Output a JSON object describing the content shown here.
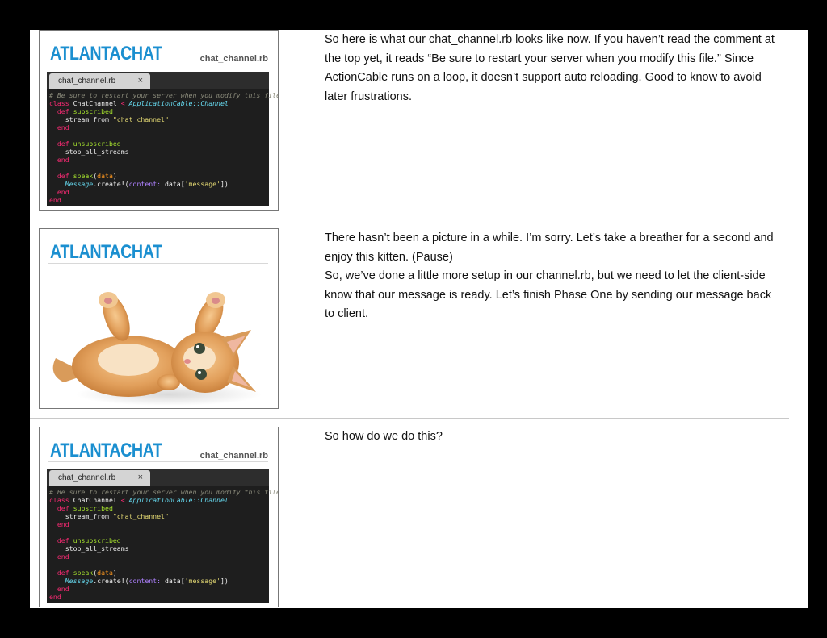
{
  "slides": [
    {
      "brand": "ATLANTACHAT",
      "file_label": "chat_channel.rb",
      "tab_label": "chat_channel.rb",
      "tab_close": "×",
      "code": {
        "l1": "# Be sure to restart your server when you modify this file.",
        "l2_kw": "class",
        "l2_name": " ChatChannel",
        "l2_op": " < ",
        "l2_parent": "ApplicationCable::Channel",
        "l3_kw": "  def",
        "l3_fn": " subscribed",
        "l4_call": "    stream_from ",
        "l4_str": "\"chat_channel\"",
        "l5": "  end",
        "l7_kw": "  def",
        "l7_fn": " unsubscribed",
        "l8": "    stop_all_streams",
        "l9": "  end",
        "l11_kw": "  def",
        "l11_fn": " speak",
        "l11_open": "(",
        "l11_arg": "data",
        "l11_close": ")",
        "l12_cls": "    Message",
        "l12_call": ".create!(",
        "l12_sym": "content:",
        "l12_rest": " data[",
        "l12_str": "'message'",
        "l12_end": "])",
        "l13": "  end",
        "l14": "end"
      },
      "note": [
        "So here is what our chat_channel.rb looks like now. If you haven’t read the comment at the top yet, it reads “Be sure to restart your server when you modify this file.” Since ActionCable runs on a loop, it doesn’t support auto reloading. Good to know to avoid later frustrations."
      ]
    },
    {
      "brand": "ATLANTACHAT",
      "image": "kitten-photo",
      "note": [
        "There hasn’t been a picture in a while. I’m sorry. Let’s take a breather for a second and enjoy this kitten. (Pause)",
        "So, we’ve done a little more setup in our channel.rb, but we need to let the client-side know that our message is ready. Let’s finish Phase One by sending our message back to client."
      ]
    },
    {
      "brand": "ATLANTACHAT",
      "file_label": "chat_channel.rb",
      "tab_label": "chat_channel.rb",
      "tab_close": "×",
      "code": {
        "l1": "# Be sure to restart your server when you modify this file.",
        "l2_kw": "class",
        "l2_name": " ChatChannel",
        "l2_op": " < ",
        "l2_parent": "ApplicationCable::Channel",
        "l3_kw": "  def",
        "l3_fn": " subscribed",
        "l4_call": "    stream_from ",
        "l4_str": "\"chat_channel\"",
        "l5": "  end",
        "l7_kw": "  def",
        "l7_fn": " unsubscribed",
        "l8": "    stop_all_streams",
        "l9": "  end",
        "l11_kw": "  def",
        "l11_fn": " speak",
        "l11_open": "(",
        "l11_arg": "data",
        "l11_close": ")",
        "l12_cls": "    Message",
        "l12_call": ".create!(",
        "l12_sym": "content:",
        "l12_rest": " data[",
        "l12_str": "'message'",
        "l12_end": "])",
        "l13": "  end",
        "l14": "end"
      },
      "note": [
        "So how do we do this?"
      ]
    }
  ]
}
